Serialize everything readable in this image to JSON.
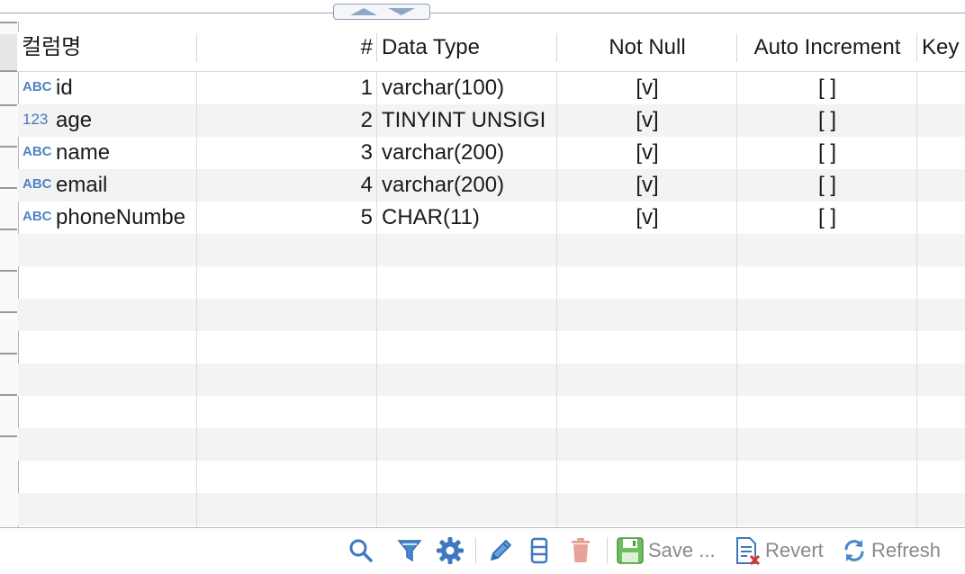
{
  "colors": {
    "accent": "#4f84c4",
    "row_alt": "#f3f3f3",
    "save": "#5aa84a",
    "delete": "#e7a29a"
  },
  "columns": [
    {
      "key": "name",
      "label": "컬럼명"
    },
    {
      "key": "index",
      "label": "#"
    },
    {
      "key": "data_type",
      "label": "Data Type"
    },
    {
      "key": "not_null",
      "label": "Not Null"
    },
    {
      "key": "auto_increment",
      "label": "Auto Increment"
    },
    {
      "key": "key",
      "label": "Key"
    }
  ],
  "rows": [
    {
      "type_icon": "ABC",
      "type_icon_name": "text-type-icon",
      "name": "id",
      "index": "1",
      "data_type": "varchar(100)",
      "not_null": "[v]",
      "auto_increment": "[ ]"
    },
    {
      "type_icon": "123",
      "type_icon_name": "number-type-icon",
      "name": "age",
      "index": "2",
      "data_type": "TINYINT UNSIGI",
      "not_null": "[v]",
      "auto_increment": "[ ]"
    },
    {
      "type_icon": "ABC",
      "type_icon_name": "text-type-icon",
      "name": "name",
      "index": "3",
      "data_type": "varchar(200)",
      "not_null": "[v]",
      "auto_increment": "[ ]"
    },
    {
      "type_icon": "ABC",
      "type_icon_name": "text-type-icon",
      "name": "email",
      "index": "4",
      "data_type": "varchar(200)",
      "not_null": "[v]",
      "auto_increment": "[ ]"
    },
    {
      "type_icon": "ABC",
      "type_icon_name": "text-type-icon",
      "name": "phoneNumbe",
      "index": "5",
      "data_type": "CHAR(11)",
      "not_null": "[v]",
      "auto_increment": "[ ]"
    }
  ],
  "toolbar": {
    "icons": [
      "search-icon",
      "filter-icon",
      "gear-icon",
      "pencil-icon",
      "columns-icon",
      "trash-icon"
    ],
    "save_label": "Save ...",
    "revert_label": "Revert",
    "refresh_label": "Refresh"
  }
}
